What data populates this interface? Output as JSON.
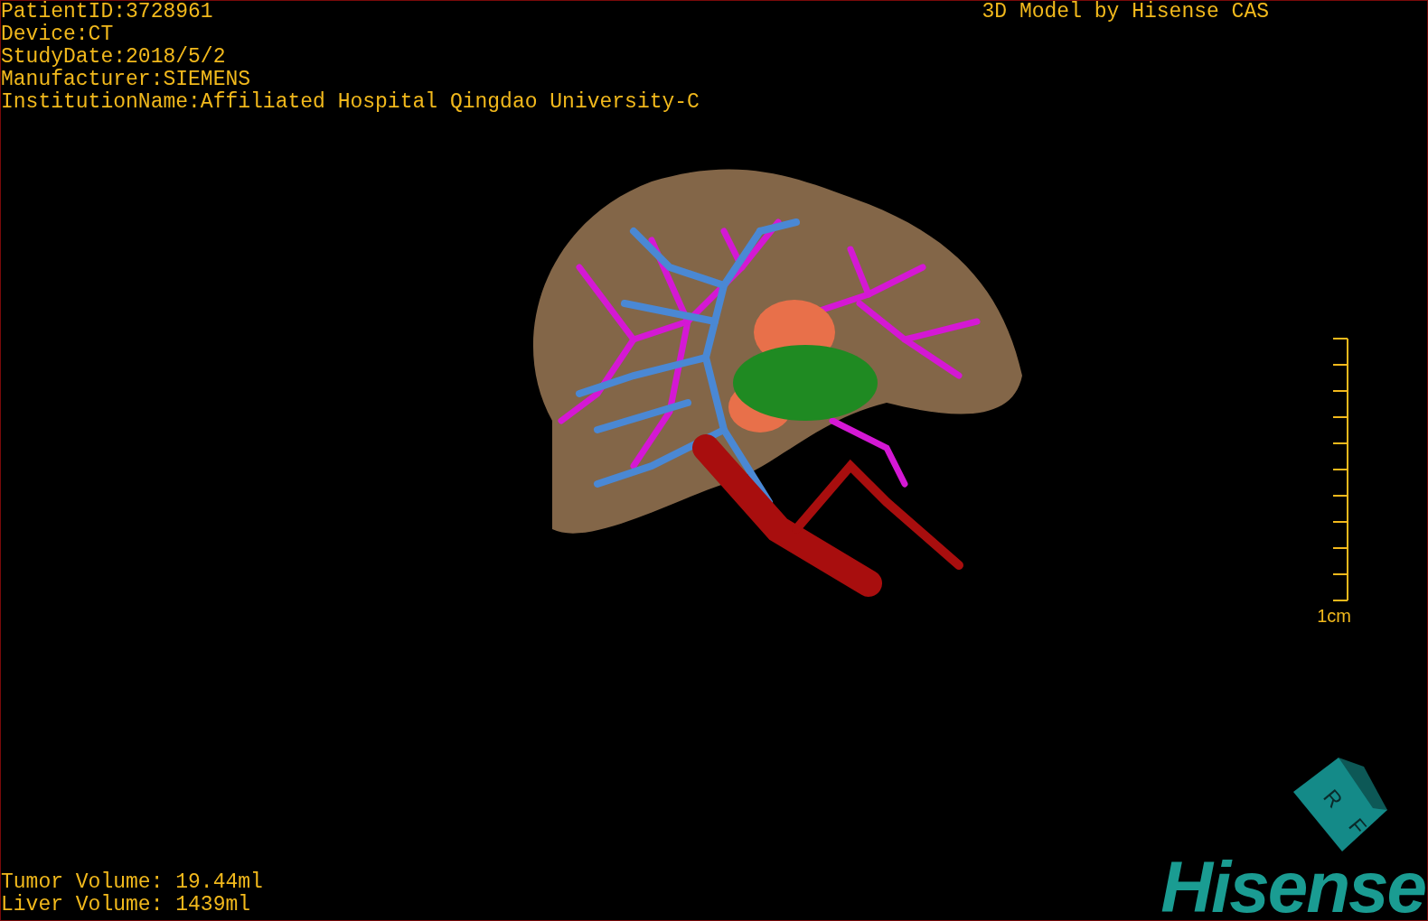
{
  "patient_info": [
    "PatientID:3728961",
    "Device:CT",
    "StudyDate:2018/5/2",
    "Manufacturer:SIEMENS",
    "InstitutionName:Affiliated Hospital Qingdao University-C"
  ],
  "title": "3D Model by Hisense CAS",
  "scale_bar": {
    "label": "1cm"
  },
  "volumes": [
    "Tumor Volume: 19.44ml",
    "Liver Volume: 1439ml"
  ],
  "orientation_cube": {
    "labels": [
      "R",
      "F"
    ]
  },
  "logo": "Hisense"
}
